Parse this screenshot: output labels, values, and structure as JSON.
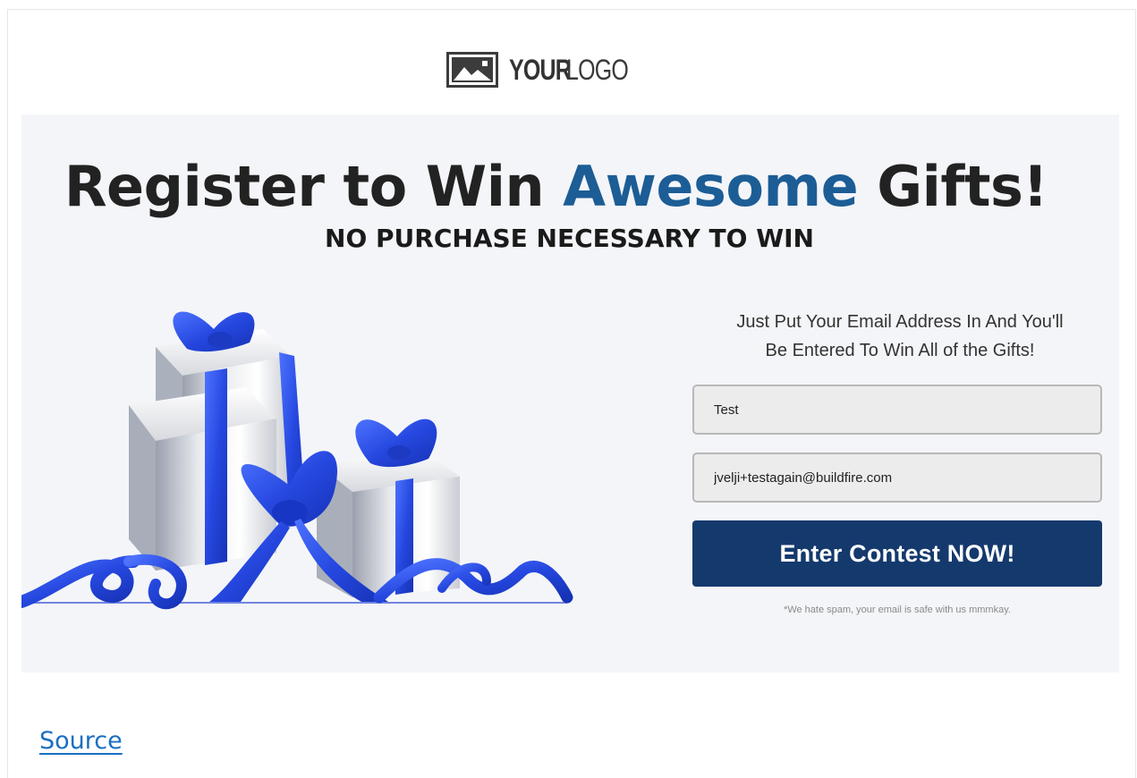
{
  "header": {
    "logo_bold": "YOUR",
    "logo_light": "LOGO",
    "logo_icon": "image-icon"
  },
  "hero": {
    "headline_before": "Register to Win ",
    "headline_accent": "Awesome",
    "headline_after": " Gifts!",
    "subheadline": "NO PURCHASE NECESSARY TO WIN",
    "illustration": "gift-boxes-icon"
  },
  "form": {
    "intro_line1": "Just Put Your Email Address In And You'll",
    "intro_line2": "Be Entered To Win All of the Gifts!",
    "name_value": "Test",
    "email_value": "jvelji+testagain@buildfire.com",
    "submit_label": "Enter Contest NOW!",
    "disclaimer": "*We hate spam, your email is safe with us mmmkay."
  },
  "footer": {
    "source_label": "Source"
  },
  "colors": {
    "accent": "#1c5d96",
    "button": "#14396d",
    "hero_bg": "#f4f5f8",
    "ribbon": "#2a52e6",
    "link": "#1a6fc0"
  }
}
